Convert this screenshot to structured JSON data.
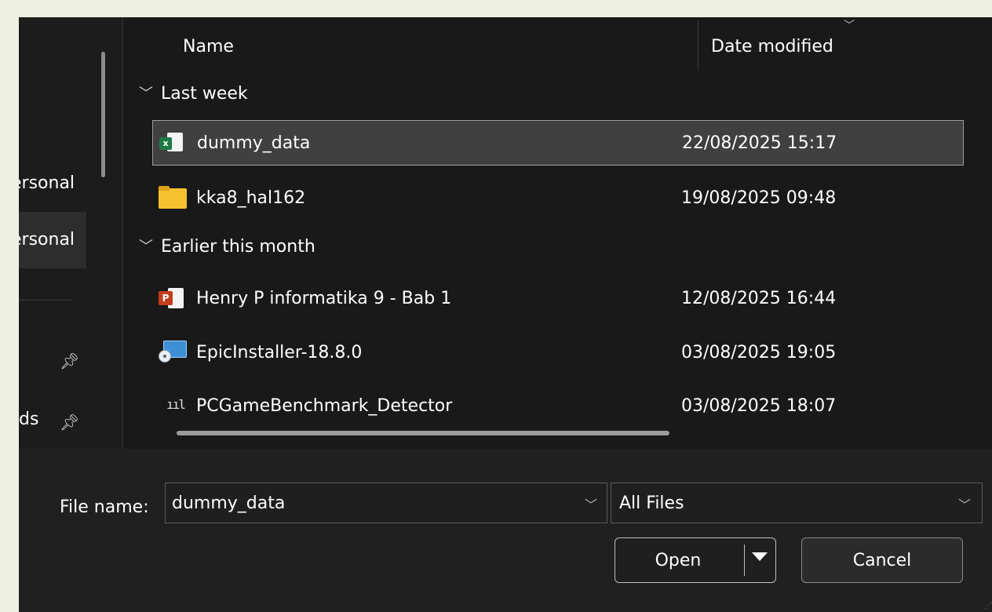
{
  "nav": {
    "items": [
      {
        "label": "ersonal"
      },
      {
        "label": "ersonal"
      }
    ],
    "short_item": "ds"
  },
  "list": {
    "columns": {
      "name": "Name",
      "date": "Date modified"
    },
    "groups": [
      {
        "title": "Last week",
        "rows": [
          {
            "name": "dummy_data",
            "date": "22/08/2025 15:17",
            "icon": "excel-file-icon"
          },
          {
            "name": "kka8_hal162",
            "date": "19/08/2025 09:48",
            "icon": "folder-icon"
          }
        ]
      },
      {
        "title": "Earlier this month",
        "rows": [
          {
            "name": "Henry P informatika 9 - Bab 1",
            "date": "12/08/2025 16:44",
            "icon": "powerpoint-file-icon"
          },
          {
            "name": "EpicInstaller-18.8.0",
            "date": "03/08/2025 19:05",
            "icon": "installer-icon"
          },
          {
            "name": "PCGameBenchmark_Detector",
            "date": "03/08/2025 18:07",
            "icon": "benchmark-app-icon"
          }
        ]
      }
    ]
  },
  "footer": {
    "file_name_label": "File name:",
    "file_name_value": "dummy_data",
    "file_type_value": "All Files",
    "open_label": "Open",
    "cancel_label": "Cancel"
  },
  "colors": {
    "background": "#1f1f1f",
    "selected_row": "#404040",
    "outer": "#eef0e2"
  }
}
